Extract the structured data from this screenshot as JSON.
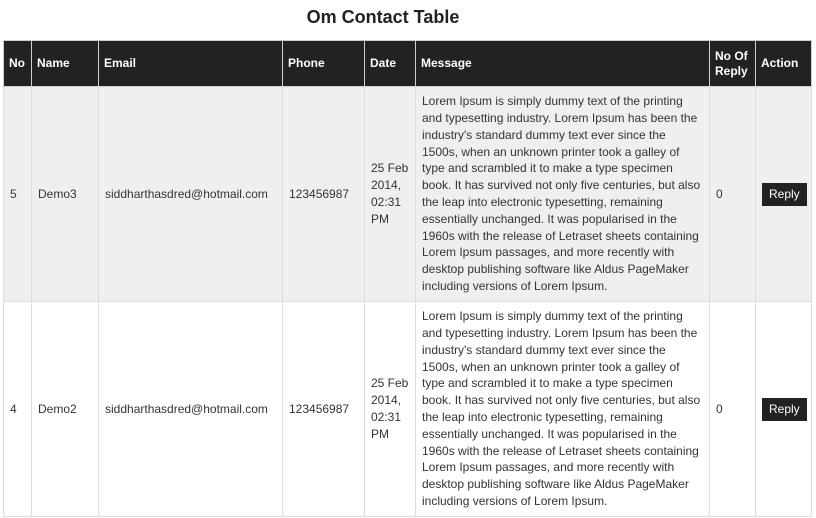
{
  "page": {
    "title": "Om Contact Table"
  },
  "table": {
    "columns": [
      {
        "key": "no",
        "label": "No"
      },
      {
        "key": "name",
        "label": "Name"
      },
      {
        "key": "email",
        "label": "Email"
      },
      {
        "key": "phone",
        "label": "Phone"
      },
      {
        "key": "date",
        "label": "Date"
      },
      {
        "key": "message",
        "label": "Message"
      },
      {
        "key": "replies",
        "label": "No Of Reply"
      },
      {
        "key": "action",
        "label": "Action"
      }
    ],
    "rows": [
      {
        "no": "5",
        "name": "Demo3",
        "email": "siddharthasdred@hotmail.com",
        "phone": "123456987",
        "date": "25 Feb 2014, 02:31 PM",
        "message": "Lorem Ipsum is simply dummy text of the printing and typesetting industry. Lorem Ipsum has been the industry's standard dummy text ever since the 1500s, when an unknown printer took a galley of type and scrambled it to make a type specimen book. It has survived not only five centuries, but also the leap into electronic typesetting, remaining essentially unchanged. It was popularised in the 1960s with the release of Letraset sheets containing Lorem Ipsum passages, and more recently with desktop publishing software like Aldus PageMaker including versions of Lorem Ipsum.",
        "replies": "0",
        "action": "Reply"
      },
      {
        "no": "4",
        "name": "Demo2",
        "email": "siddharthasdred@hotmail.com",
        "phone": "123456987",
        "date": "25 Feb 2014, 02:31 PM",
        "message": "Lorem Ipsum is simply dummy text of the printing and typesetting industry. Lorem Ipsum has been the industry's standard dummy text ever since the 1500s, when an unknown printer took a galley of type and scrambled it to make a type specimen book. It has survived not only five centuries, but also the leap into electronic typesetting, remaining essentially unchanged. It was popularised in the 1960s with the release of Letraset sheets containing Lorem Ipsum passages, and more recently with desktop publishing software like Aldus PageMaker including versions of Lorem Ipsum.",
        "replies": "0",
        "action": "Reply"
      }
    ]
  },
  "colors": {
    "header_bg": "#222222",
    "header_text": "#ffffff",
    "row_odd_bg": "#efefef",
    "row_even_bg": "#ffffff",
    "button_bg": "#222222"
  }
}
